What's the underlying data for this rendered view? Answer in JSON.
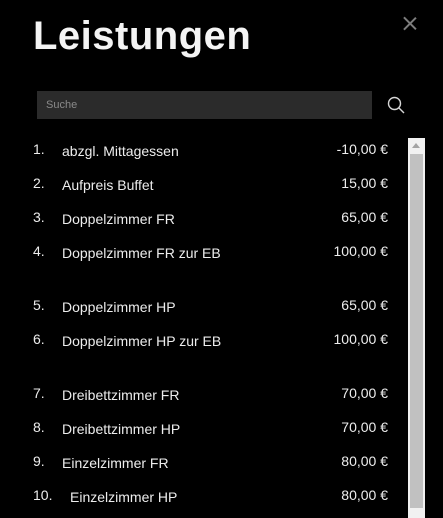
{
  "title": "Leistungen",
  "search": {
    "placeholder": "Suche"
  },
  "items": [
    {
      "num": "1.",
      "name": "abzgl. Mittagessen",
      "price": "-10,00 €"
    },
    {
      "num": "2.",
      "name": "Aufpreis Buffet",
      "price": "15,00 €"
    },
    {
      "num": "3.",
      "name": "Doppelzimmer FR",
      "price": "65,00 €"
    },
    {
      "num": "4.",
      "name": "Doppelzimmer FR zur EB",
      "price": "100,00 €"
    },
    {
      "num": "5.",
      "name": "Doppelzimmer HP",
      "price": "65,00 €"
    },
    {
      "num": "6.",
      "name": "Doppelzimmer HP zur EB",
      "price": "100,00 €"
    },
    {
      "num": "7.",
      "name": "Dreibettzimmer FR",
      "price": "70,00 €"
    },
    {
      "num": "8.",
      "name": "Dreibettzimmer HP",
      "price": "70,00 €"
    },
    {
      "num": "9.",
      "name": "Einzelzimmer FR",
      "price": "80,00 €"
    },
    {
      "num": "10.",
      "name": "Einzelzimmer HP",
      "price": "80,00 €"
    }
  ]
}
